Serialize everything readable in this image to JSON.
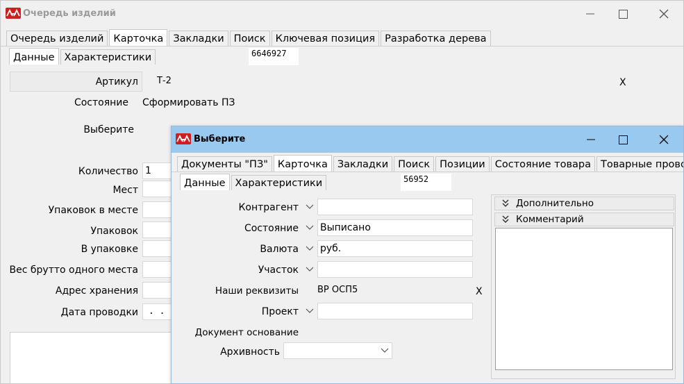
{
  "main_window": {
    "title": "Очередь изделий",
    "tabs": [
      "Очередь изделий",
      "Карточка",
      "Закладки",
      "Поиск",
      "Ключевая позиция",
      "Разработка дерева"
    ],
    "active_tab": 1,
    "subtabs": [
      "Данные",
      "Характеристики"
    ],
    "record_id": "6646927",
    "articul_label": "Артикул",
    "articul_value": "Т-2",
    "clear_x": "X",
    "state_label": "Состояние",
    "state_value": "Сформировать ПЗ",
    "choose_label": "Выберите",
    "quantity_label": "Количество",
    "quantity_value": "1",
    "places_label": "Мест",
    "packs_per_place_label": "Упаковок в месте",
    "packs_label": "Упаковок",
    "in_pack_label": "В упаковке",
    "gross_weight_label": "Вес брутто одного места",
    "storage_address_label": "Адрес хранения",
    "posting_date_label": "Дата проводки",
    "posting_date_value": ". ."
  },
  "dialog": {
    "title": "Выберите",
    "tabs": [
      "Документы \"ПЗ\"",
      "Карточка",
      "Закладки",
      "Поиск",
      "Позиции",
      "Состояние товара",
      "Товарные проводки"
    ],
    "active_tab": 1,
    "subtabs": [
      "Данные",
      "Характеристики"
    ],
    "record_id": "56952",
    "contractor_label": "Контрагент",
    "contractor_value": "",
    "state_label": "Состояние",
    "state_value": "Выписано",
    "currency_label": "Валюта",
    "currency_value": "руб.",
    "section_label": "Участок",
    "section_value": "",
    "requisites_label": "Наши реквизиты",
    "requisites_value": "ВР ОСП5",
    "requisites_clear": "X",
    "project_label": "Проект",
    "project_value": "",
    "base_doc_label": "Документ основание",
    "archive_label": "Архивность",
    "archive_value": "",
    "additional_label": "Дополнительно",
    "comment_label": "Комментарий",
    "comment_value": ""
  },
  "colors": {
    "dialog_titlebar": "#99c9ef",
    "app_icon": "#cc1f1f",
    "window_bg": "#f0f0f0"
  },
  "icons": {
    "app": "app-logo-icon",
    "minimize": "minimize-icon",
    "maximize": "maximize-icon",
    "close": "close-icon",
    "dropdown": "chevron-down-icon",
    "collapse": "double-chevron-down-icon"
  }
}
